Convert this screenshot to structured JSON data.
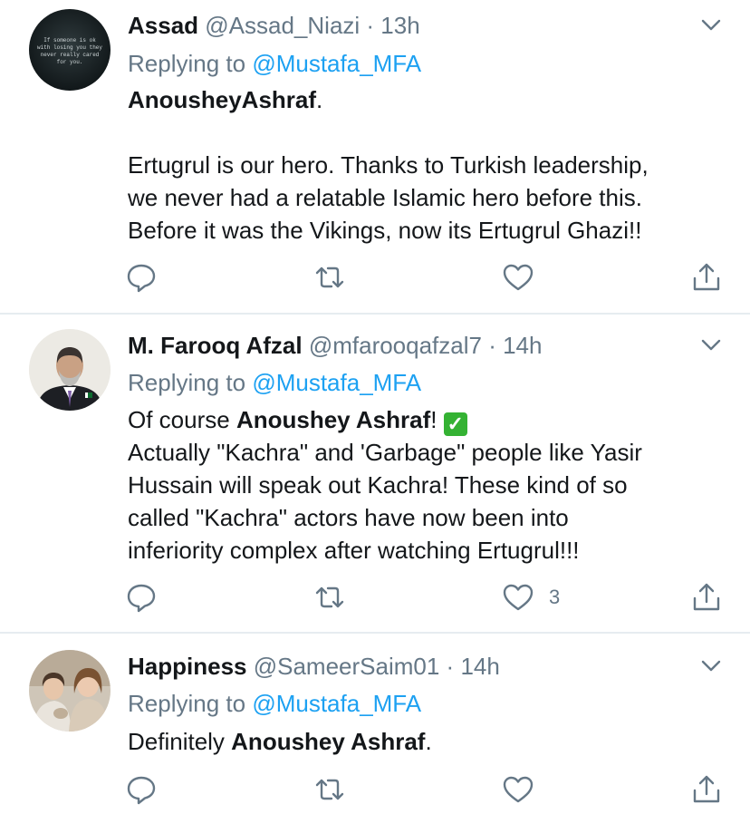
{
  "tweets": [
    {
      "name": "Assad",
      "handle": "@Assad_Niazi",
      "time": "13h",
      "replying_prefix": "Replying to",
      "replying_to": "@Mustafa_MFA",
      "avatar_text": "If someone is ok with losing you they never really cared for you.",
      "body": {
        "mention_bold": "AnousheyAshraf",
        "after_mention": ".",
        "lines": [
          "Ertugrul is our hero. Thanks to Turkish leadership,",
          "we never had a relatable Islamic hero before this.",
          "Before it was the Vikings, now its Ertugrul Ghazi!!"
        ]
      },
      "like_count": ""
    },
    {
      "name": "M. Farooq Afzal",
      "handle": "@mfarooqafzal7",
      "time": "14h",
      "replying_prefix": "Replying to",
      "replying_to": "@Mustafa_MFA",
      "body": {
        "prefix": "Of course ",
        "mention_bold": "Anoushey Ashraf",
        "after_mention": "!",
        "check_emoji": "✓",
        "lines": [
          "Actually \"Kachra\" and 'Garbage\" people like Yasir",
          "Hussain will speak out Kachra! These kind of so",
          "called \"Kachra\" actors have now been into",
          "inferiority complex after watching Ertugrul!!!"
        ]
      },
      "like_count": "3"
    },
    {
      "name": "Happiness",
      "handle": "@SameerSaim01",
      "time": "14h",
      "replying_prefix": "Replying to",
      "replying_to": "@Mustafa_MFA",
      "body": {
        "prefix": "Definitely ",
        "mention_bold": "Anoushey Ashraf",
        "after_mention": "."
      },
      "like_count": ""
    }
  ],
  "separator": " · ",
  "icons": [
    "reply-icon",
    "retweet-icon",
    "like-icon",
    "share-icon",
    "chevron-down-icon"
  ],
  "colors": {
    "name": "#14171a",
    "muted": "#657786",
    "link": "#1da1f2",
    "divider": "#e6ecf0",
    "check": "#34b233"
  }
}
